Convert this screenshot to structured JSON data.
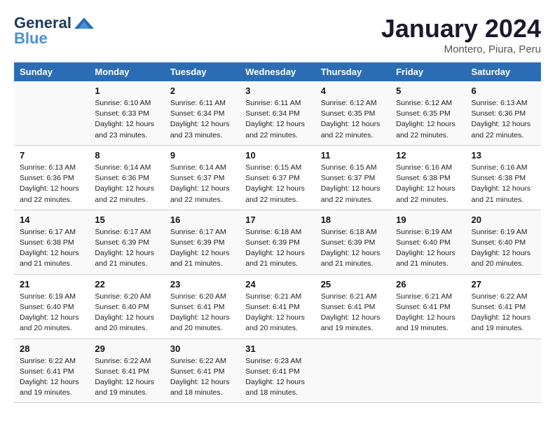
{
  "header": {
    "logo_general": "General",
    "logo_blue": "Blue",
    "month": "January 2024",
    "location": "Montero, Piura, Peru"
  },
  "weekdays": [
    "Sunday",
    "Monday",
    "Tuesday",
    "Wednesday",
    "Thursday",
    "Friday",
    "Saturday"
  ],
  "weeks": [
    [
      {
        "day": "",
        "sunrise": "",
        "sunset": "",
        "daylight": ""
      },
      {
        "day": "1",
        "sunrise": "Sunrise: 6:10 AM",
        "sunset": "Sunset: 6:33 PM",
        "daylight": "Daylight: 12 hours and 23 minutes."
      },
      {
        "day": "2",
        "sunrise": "Sunrise: 6:11 AM",
        "sunset": "Sunset: 6:34 PM",
        "daylight": "Daylight: 12 hours and 23 minutes."
      },
      {
        "day": "3",
        "sunrise": "Sunrise: 6:11 AM",
        "sunset": "Sunset: 6:34 PM",
        "daylight": "Daylight: 12 hours and 22 minutes."
      },
      {
        "day": "4",
        "sunrise": "Sunrise: 6:12 AM",
        "sunset": "Sunset: 6:35 PM",
        "daylight": "Daylight: 12 hours and 22 minutes."
      },
      {
        "day": "5",
        "sunrise": "Sunrise: 6:12 AM",
        "sunset": "Sunset: 6:35 PM",
        "daylight": "Daylight: 12 hours and 22 minutes."
      },
      {
        "day": "6",
        "sunrise": "Sunrise: 6:13 AM",
        "sunset": "Sunset: 6:36 PM",
        "daylight": "Daylight: 12 hours and 22 minutes."
      }
    ],
    [
      {
        "day": "7",
        "sunrise": "Sunrise: 6:13 AM",
        "sunset": "Sunset: 6:36 PM",
        "daylight": "Daylight: 12 hours and 22 minutes."
      },
      {
        "day": "8",
        "sunrise": "Sunrise: 6:14 AM",
        "sunset": "Sunset: 6:36 PM",
        "daylight": "Daylight: 12 hours and 22 minutes."
      },
      {
        "day": "9",
        "sunrise": "Sunrise: 6:14 AM",
        "sunset": "Sunset: 6:37 PM",
        "daylight": "Daylight: 12 hours and 22 minutes."
      },
      {
        "day": "10",
        "sunrise": "Sunrise: 6:15 AM",
        "sunset": "Sunset: 6:37 PM",
        "daylight": "Daylight: 12 hours and 22 minutes."
      },
      {
        "day": "11",
        "sunrise": "Sunrise: 6:15 AM",
        "sunset": "Sunset: 6:37 PM",
        "daylight": "Daylight: 12 hours and 22 minutes."
      },
      {
        "day": "12",
        "sunrise": "Sunrise: 6:16 AM",
        "sunset": "Sunset: 6:38 PM",
        "daylight": "Daylight: 12 hours and 22 minutes."
      },
      {
        "day": "13",
        "sunrise": "Sunrise: 6:16 AM",
        "sunset": "Sunset: 6:38 PM",
        "daylight": "Daylight: 12 hours and 21 minutes."
      }
    ],
    [
      {
        "day": "14",
        "sunrise": "Sunrise: 6:17 AM",
        "sunset": "Sunset: 6:38 PM",
        "daylight": "Daylight: 12 hours and 21 minutes."
      },
      {
        "day": "15",
        "sunrise": "Sunrise: 6:17 AM",
        "sunset": "Sunset: 6:39 PM",
        "daylight": "Daylight: 12 hours and 21 minutes."
      },
      {
        "day": "16",
        "sunrise": "Sunrise: 6:17 AM",
        "sunset": "Sunset: 6:39 PM",
        "daylight": "Daylight: 12 hours and 21 minutes."
      },
      {
        "day": "17",
        "sunrise": "Sunrise: 6:18 AM",
        "sunset": "Sunset: 6:39 PM",
        "daylight": "Daylight: 12 hours and 21 minutes."
      },
      {
        "day": "18",
        "sunrise": "Sunrise: 6:18 AM",
        "sunset": "Sunset: 6:39 PM",
        "daylight": "Daylight: 12 hours and 21 minutes."
      },
      {
        "day": "19",
        "sunrise": "Sunrise: 6:19 AM",
        "sunset": "Sunset: 6:40 PM",
        "daylight": "Daylight: 12 hours and 21 minutes."
      },
      {
        "day": "20",
        "sunrise": "Sunrise: 6:19 AM",
        "sunset": "Sunset: 6:40 PM",
        "daylight": "Daylight: 12 hours and 20 minutes."
      }
    ],
    [
      {
        "day": "21",
        "sunrise": "Sunrise: 6:19 AM",
        "sunset": "Sunset: 6:40 PM",
        "daylight": "Daylight: 12 hours and 20 minutes."
      },
      {
        "day": "22",
        "sunrise": "Sunrise: 6:20 AM",
        "sunset": "Sunset: 6:40 PM",
        "daylight": "Daylight: 12 hours and 20 minutes."
      },
      {
        "day": "23",
        "sunrise": "Sunrise: 6:20 AM",
        "sunset": "Sunset: 6:41 PM",
        "daylight": "Daylight: 12 hours and 20 minutes."
      },
      {
        "day": "24",
        "sunrise": "Sunrise: 6:21 AM",
        "sunset": "Sunset: 6:41 PM",
        "daylight": "Daylight: 12 hours and 20 minutes."
      },
      {
        "day": "25",
        "sunrise": "Sunrise: 6:21 AM",
        "sunset": "Sunset: 6:41 PM",
        "daylight": "Daylight: 12 hours and 19 minutes."
      },
      {
        "day": "26",
        "sunrise": "Sunrise: 6:21 AM",
        "sunset": "Sunset: 6:41 PM",
        "daylight": "Daylight: 12 hours and 19 minutes."
      },
      {
        "day": "27",
        "sunrise": "Sunrise: 6:22 AM",
        "sunset": "Sunset: 6:41 PM",
        "daylight": "Daylight: 12 hours and 19 minutes."
      }
    ],
    [
      {
        "day": "28",
        "sunrise": "Sunrise: 6:22 AM",
        "sunset": "Sunset: 6:41 PM",
        "daylight": "Daylight: 12 hours and 19 minutes."
      },
      {
        "day": "29",
        "sunrise": "Sunrise: 6:22 AM",
        "sunset": "Sunset: 6:41 PM",
        "daylight": "Daylight: 12 hours and 19 minutes."
      },
      {
        "day": "30",
        "sunrise": "Sunrise: 6:22 AM",
        "sunset": "Sunset: 6:41 PM",
        "daylight": "Daylight: 12 hours and 18 minutes."
      },
      {
        "day": "31",
        "sunrise": "Sunrise: 6:23 AM",
        "sunset": "Sunset: 6:41 PM",
        "daylight": "Daylight: 12 hours and 18 minutes."
      },
      {
        "day": "",
        "sunrise": "",
        "sunset": "",
        "daylight": ""
      },
      {
        "day": "",
        "sunrise": "",
        "sunset": "",
        "daylight": ""
      },
      {
        "day": "",
        "sunrise": "",
        "sunset": "",
        "daylight": ""
      }
    ]
  ]
}
